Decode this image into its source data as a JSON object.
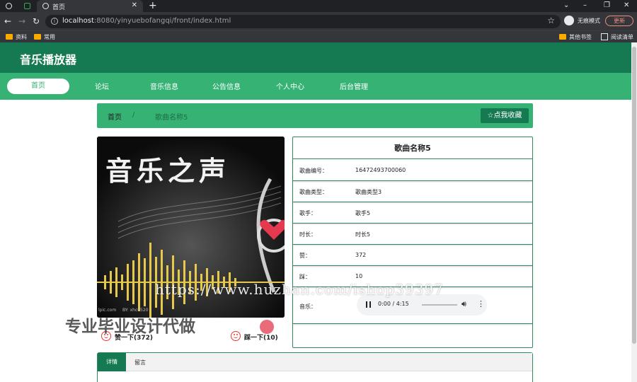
{
  "browser": {
    "tab_title": "首页",
    "url_host": "localhost",
    "url_rest": ":8080/yinyuebofangqi/front/index.html",
    "incognito_label": "无痕模式",
    "update_label": "更新",
    "bookmarks": [
      "资料",
      "常用"
    ],
    "bookmarks_right": [
      "其他书签",
      "阅读清单"
    ]
  },
  "site": {
    "title": "音乐播放器",
    "nav": [
      "首页",
      "论坛",
      "音乐信息",
      "公告信息",
      "个人中心",
      "后台管理"
    ]
  },
  "breadcrumb": {
    "home": "首页",
    "separator": "/",
    "current": "歌曲名称5",
    "favorite_button": "☆点我收藏"
  },
  "cover": {
    "art_text": "音乐之声",
    "credit_left": "lpic.com",
    "credit_right": "BY: xhc0520"
  },
  "song": {
    "title": "歌曲名称5",
    "fields": [
      {
        "key": "歌曲编号：",
        "value": "16472493700060"
      },
      {
        "key": "歌曲类型：",
        "value": "歌曲类型3"
      },
      {
        "key": "歌手：",
        "value": "歌手5"
      },
      {
        "key": "时长：",
        "value": "时长5"
      },
      {
        "key": "赞：",
        "value": "372"
      },
      {
        "key": "踩：",
        "value": "10"
      }
    ],
    "audio_label": "音乐：",
    "audio_time": "0:00 / 4:15"
  },
  "votes": {
    "like": "赞一下(372)",
    "dislike": "踩一下(10)"
  },
  "tabs": [
    "详情",
    "留言"
  ],
  "watermarks": {
    "url": "https://www.huzhan.com/ishop39397",
    "text": "专业毕业设计代做"
  },
  "colors": {
    "header_dark": "#157a52",
    "nav_green": "#36b374",
    "border_green": "#2e8b5e"
  }
}
